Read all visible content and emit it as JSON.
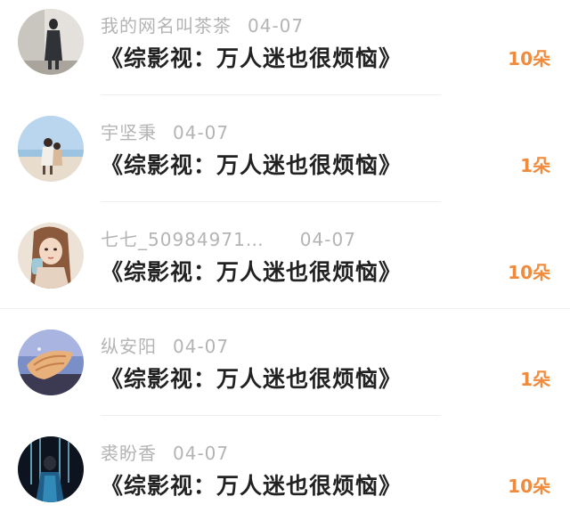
{
  "items": [
    {
      "name": "我的网名叫茶茶",
      "date": "04-07",
      "title": "《综影视：万人迷也很烦恼》",
      "gift": "10朵",
      "avatar": "avatar-photo-woman-standing"
    },
    {
      "name": "宇坚秉",
      "date": "04-07",
      "title": "《综影视：万人迷也很烦恼》",
      "gift": "1朵",
      "avatar": "avatar-photo-beach"
    },
    {
      "name": "七七_50984971…",
      "date": "04-07",
      "title": "《综影视：万人迷也很烦恼》",
      "gift": "10朵",
      "avatar": "avatar-illustration-girl"
    },
    {
      "name": "纵安阳",
      "date": "04-07",
      "title": "《综影视：万人迷也很烦恼》",
      "gift": "1朵",
      "avatar": "avatar-photo-seashell"
    },
    {
      "name": "裘盼香",
      "date": "04-07",
      "title": "《综影视：万人迷也很烦恼》",
      "gift": "10朵",
      "avatar": "avatar-photo-light-figure"
    }
  ],
  "colors": {
    "gift": "#f08a3c",
    "meta": "#b4b4b4",
    "title": "#222222"
  }
}
